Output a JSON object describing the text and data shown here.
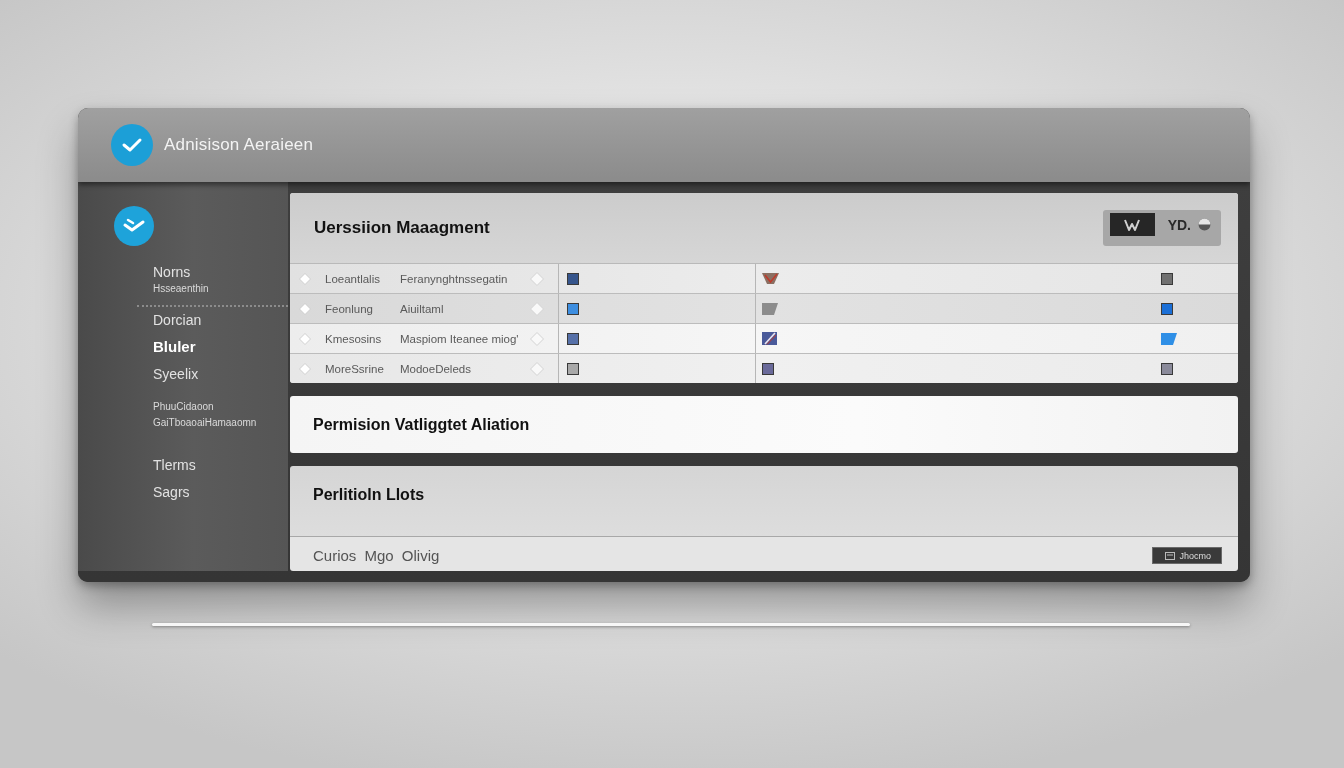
{
  "window": {
    "title": "Adnisison Aeraieen"
  },
  "sidebar": {
    "groups": [
      {
        "divider_below": true,
        "items": [
          {
            "label": "Norns",
            "selected": false
          }
        ],
        "notes": [
          "Hsseaenthin"
        ]
      },
      {
        "items": [
          {
            "label": "Dorcian",
            "selected": false
          },
          {
            "label": "Bluler",
            "selected": true
          },
          {
            "label": "Syeelix",
            "selected": false
          }
        ]
      },
      {
        "notes": [
          "PhuuCidaoon",
          "GaiTboaoaiHamaaomn"
        ]
      },
      {
        "items": [
          {
            "label": "Tlerms",
            "selected": false
          },
          {
            "label": "Sagrs",
            "selected": false
          }
        ]
      }
    ]
  },
  "version_panel": {
    "title": "Uerssiion Maaagment",
    "view_toggle": [
      {
        "kind": "icon",
        "selected": true
      },
      {
        "kind": "text",
        "label": "YD.",
        "selected": false
      }
    ],
    "rows": [
      {
        "column_1": "Loeantlalis",
        "column_2": "Feranynghtnssegatin",
        "marks": [
          {
            "kind": "square",
            "color": "#36558c"
          },
          {
            "kind": "check",
            "color": "#8b6f62"
          },
          {
            "kind": "square",
            "color": "#707070"
          }
        ]
      },
      {
        "column_1": "Feonlung",
        "column_2": "Aiuiltaml",
        "marks": [
          {
            "kind": "square",
            "color": "#3d8ee0"
          },
          {
            "kind": "tab",
            "color": "#8c8c8c"
          },
          {
            "kind": "square",
            "color": "#1b6fd6"
          }
        ]
      },
      {
        "column_1": "Kmesosins",
        "column_2": "Maspiom Iteanee miog'",
        "marks": [
          {
            "kind": "square",
            "color": "#5670a8"
          },
          {
            "kind": "slash",
            "color": "#4a5a9a"
          },
          {
            "kind": "tab",
            "color": "#2f8fe6"
          }
        ]
      },
      {
        "column_1": "MoreSsrine",
        "column_2": "ModoeDeleds",
        "marks": [
          {
            "kind": "square",
            "color": "#a8a8a8"
          },
          {
            "kind": "square",
            "color": "#6a6a9a"
          },
          {
            "kind": "square",
            "color": "#8a8a9a"
          }
        ]
      }
    ]
  },
  "permission_panel": {
    "title": "Permision Vatliggtet Aliation"
  },
  "list_panel": {
    "title": "Perlitioln Llots",
    "footer_text": "Curios Mgo Olivig",
    "button": "Jhocmo"
  }
}
